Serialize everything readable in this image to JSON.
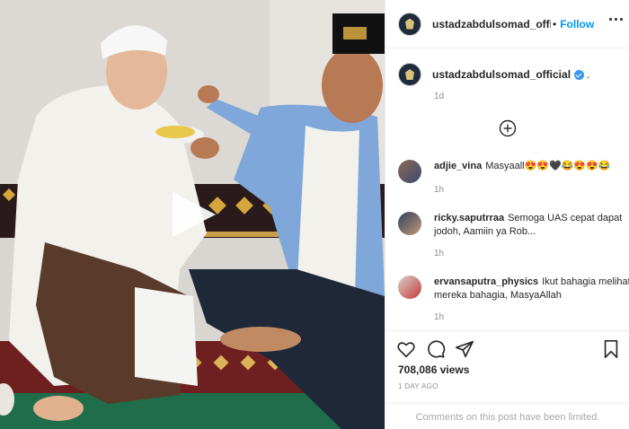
{
  "header": {
    "username": "ustadzabdulsomad_official",
    "separator": "•",
    "follow_label": "Follow"
  },
  "caption": {
    "username": "ustadzabdulsomad_official",
    "text": ".",
    "time": "1d"
  },
  "comments": [
    {
      "username": "adjie_vina",
      "text": "Masyaall😍😍🖤😂😍😍😂",
      "time": "1h"
    },
    {
      "username": "ricky.saputrraa",
      "text": "Semoga UAS cepat dapat jodoh, Aamiin ya Rob...",
      "time": "1h"
    },
    {
      "username": "ervansaputra_physics",
      "text": "Ikut bahagia melihat mereka bahagia, MasyaAllah",
      "time": "1h"
    }
  ],
  "stats": {
    "views": "708,086 views",
    "date": "1 DAY AGO"
  },
  "footer": {
    "limited_text": "Comments on this post have been limited."
  },
  "icons": {
    "play": "play-icon",
    "more": "more-options-icon",
    "load_more": "plus-circle-icon",
    "like": "heart-icon",
    "comment": "comment-icon",
    "share": "share-icon",
    "save": "bookmark-icon"
  },
  "colors": {
    "accent": "#0095f6",
    "verified": "#3897f0"
  }
}
